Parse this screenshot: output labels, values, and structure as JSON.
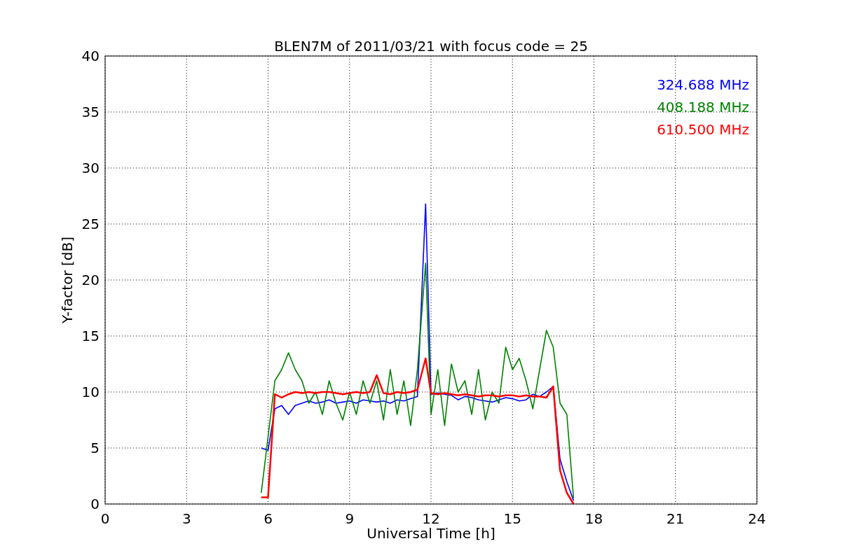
{
  "figure": {
    "chart_data": {
      "type": "line",
      "title": "BLEN7M of 2011/03/21 with focus code = 25",
      "xlabel": "Universal Time [h]",
      "ylabel": "Y-factor [dB]",
      "x": [
        5.75,
        6,
        6.25,
        6.5,
        6.75,
        7,
        7.25,
        7.5,
        7.75,
        8,
        8.25,
        8.5,
        8.75,
        9,
        9.25,
        9.5,
        9.75,
        10,
        10.25,
        10.5,
        10.75,
        11,
        11.25,
        11.5,
        11.8,
        12,
        12.25,
        12.5,
        12.75,
        13,
        13.25,
        13.5,
        13.75,
        14,
        14.25,
        14.5,
        14.75,
        15,
        15.25,
        15.5,
        15.75,
        16,
        16.25,
        16.5,
        16.75,
        17,
        17.25
      ],
      "series": [
        {
          "name": "324.688 MHz",
          "color": "#0000ff",
          "values": [
            5,
            4.8,
            8.5,
            8.8,
            8,
            8.8,
            9,
            9.2,
            9,
            9.1,
            9.3,
            9,
            9.1,
            9.2,
            9,
            9.3,
            9.2,
            9.1,
            9.2,
            9,
            9.3,
            9.2,
            9.4,
            9.6,
            26.8,
            9.8,
            9.9,
            9.8,
            9.7,
            9.3,
            9.6,
            9.5,
            9.3,
            9.2,
            9.1,
            9.3,
            9.5,
            9.4,
            9.2,
            9.3,
            9.8,
            9.6,
            10,
            10.5,
            4,
            2,
            0.3
          ]
        },
        {
          "name": "408.188 MHz",
          "color": "#008000",
          "values": [
            1,
            6,
            11,
            12,
            13.5,
            12,
            11,
            9,
            10,
            8,
            11,
            9,
            7.5,
            10,
            8,
            11,
            9,
            11,
            7.5,
            12,
            8,
            11,
            7,
            12,
            21.5,
            8,
            12,
            7,
            12.5,
            10,
            11,
            8,
            12,
            7.5,
            10,
            9,
            14,
            12,
            13,
            11,
            8.5,
            12,
            15.5,
            14,
            9,
            8,
            0.5
          ]
        },
        {
          "name": "610.500 MHz",
          "color": "#ff0000",
          "values": [
            0.6,
            0.6,
            9.8,
            9.5,
            9.8,
            10,
            9.9,
            10,
            9.9,
            10,
            10,
            9.9,
            9.8,
            9.9,
            10,
            9.9,
            10,
            11.5,
            9.9,
            9.8,
            10,
            9.9,
            10,
            10.2,
            13,
            9.9,
            9.8,
            9.9,
            9.8,
            9.7,
            9.8,
            9.7,
            9.6,
            9.7,
            9.7,
            9.6,
            9.7,
            9.7,
            9.6,
            9.7,
            9.6,
            9.6,
            9.5,
            10.5,
            3,
            1,
            0
          ]
        }
      ],
      "grid": true,
      "xlim": [
        0,
        24
      ],
      "ylim": [
        0,
        40
      ],
      "xticks": [
        0,
        3,
        6,
        9,
        12,
        15,
        18,
        21,
        24
      ],
      "yticks": [
        0,
        5,
        10,
        15,
        20,
        25,
        30,
        35,
        40
      ]
    }
  }
}
